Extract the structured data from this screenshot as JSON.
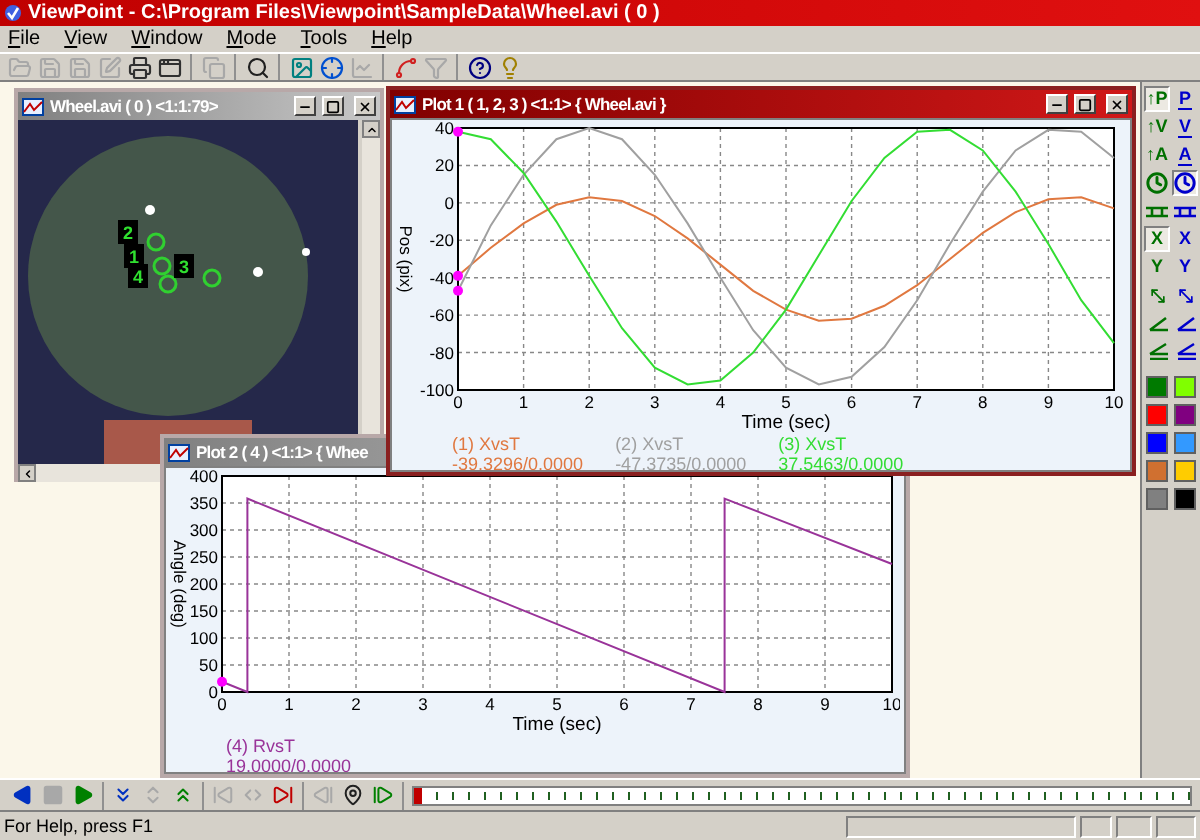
{
  "app_title": "ViewPoint - C:\\Program Files\\Viewpoint\\SampleData\\Wheel.avi ( 0 )",
  "menu": [
    "File",
    "View",
    "Window",
    "Mode",
    "Tools",
    "Help"
  ],
  "toolbar": [
    [
      {
        "kind": "open",
        "disabled": true
      },
      {
        "kind": "save",
        "disabled": true
      },
      {
        "kind": "save",
        "disabled": true
      },
      {
        "kind": "edit",
        "disabled": true
      },
      {
        "kind": "print",
        "disabled": false
      },
      {
        "kind": "window",
        "disabled": false
      }
    ],
    [
      {
        "kind": "copy",
        "disabled": true
      }
    ],
    [
      {
        "kind": "zoom",
        "disabled": false
      }
    ],
    [
      {
        "kind": "image",
        "disabled": false
      },
      {
        "kind": "target",
        "disabled": false
      },
      {
        "kind": "chart",
        "disabled": true
      }
    ],
    [
      {
        "kind": "points",
        "disabled": false
      },
      {
        "kind": "filter",
        "disabled": true
      }
    ],
    [
      {
        "kind": "help",
        "disabled": false
      },
      {
        "kind": "tip",
        "disabled": false
      }
    ]
  ],
  "video_window": {
    "title": "Wheel.avi ( 0 ) <1:1:79>",
    "active": false,
    "markers": [
      {
        "label": "2"
      },
      {
        "label": "1"
      },
      {
        "label": "4"
      },
      {
        "label": "3"
      }
    ]
  },
  "plot_window_1": {
    "title": "Plot 1 ( 1, 2, 3 ) <1:1> { Wheel.avi }",
    "active": true,
    "chart_data": {
      "type": "line",
      "xlabel": "Time (sec)",
      "ylabel": "Pos (pix)",
      "xlim": [
        0,
        10
      ],
      "ylim": [
        -100,
        40
      ],
      "xticks": [
        0,
        1,
        2,
        3,
        4,
        5,
        6,
        7,
        8,
        9,
        10
      ],
      "yticks": [
        -100,
        -80,
        -60,
        -40,
        -20,
        0,
        20,
        40
      ],
      "grid": true,
      "x": [
        0,
        0.5,
        1,
        1.5,
        2,
        2.5,
        3,
        3.5,
        4,
        4.5,
        5,
        5.5,
        6,
        6.5,
        7,
        7.5,
        8,
        8.5,
        9,
        9.5,
        10
      ],
      "series": [
        {
          "name": "(1) XvsT",
          "color": "#e07840",
          "values": [
            -39,
            -24,
            -11,
            -1,
            3,
            1,
            -7,
            -19,
            -33,
            -47,
            -57,
            -63,
            -62,
            -55,
            -44,
            -30,
            -16,
            -5,
            2,
            3,
            -3
          ]
        },
        {
          "name": "(2) XvsT",
          "color": "#a0a0a0",
          "values": [
            -47,
            -12,
            15,
            34,
            40,
            34,
            15,
            -11,
            -40,
            -68,
            -88,
            -97,
            -93,
            -77,
            -52,
            -22,
            6,
            28,
            39,
            38,
            24
          ]
        },
        {
          "name": "(3) XvsT",
          "color": "#33dd33",
          "values": [
            38,
            34,
            16,
            -10,
            -39,
            -67,
            -88,
            -97,
            -95,
            -80,
            -57,
            -28,
            1,
            24,
            38,
            39,
            28,
            6,
            -22,
            -52,
            -75
          ]
        }
      ]
    },
    "readings": [
      "-39.3296/0.0000",
      "-47.3735/0.0000",
      "37.5463/0.0000"
    ]
  },
  "plot_window_2": {
    "title": "Plot 2 ( 4 ) <1:1> { Whee",
    "active": false,
    "chart_data": {
      "type": "line",
      "xlabel": "Time (sec)",
      "ylabel": "Angle (deg)",
      "xlim": [
        0,
        10
      ],
      "ylim": [
        0,
        400
      ],
      "xticks": [
        0,
        1,
        2,
        3,
        4,
        5,
        6,
        7,
        8,
        9,
        10
      ],
      "yticks": [
        0,
        50,
        100,
        150,
        200,
        250,
        300,
        350,
        400
      ],
      "grid": true,
      "x": [
        0,
        0.38,
        0.38,
        7.5,
        7.5,
        10
      ],
      "series": [
        {
          "name": "(4) RvsT",
          "color": "#993399",
          "values": [
            19,
            0,
            358,
            0,
            358,
            237
          ]
        }
      ]
    },
    "readings": [
      "19.0000/0.0000"
    ]
  },
  "tool_palette": [
    {
      "kind": "letter",
      "label": "↑P",
      "color": "#007000",
      "selected": true
    },
    {
      "kind": "vector",
      "label": "P",
      "color": "#0000cc",
      "selected": false
    },
    {
      "kind": "letter",
      "label": "↑V",
      "color": "#007000",
      "selected": false
    },
    {
      "kind": "vector",
      "label": "V",
      "color": "#0000cc",
      "selected": false
    },
    {
      "kind": "letter",
      "label": "↑A",
      "color": "#007000",
      "selected": false
    },
    {
      "kind": "vector",
      "label": "A",
      "color": "#0000cc",
      "selected": false
    },
    {
      "kind": "clock",
      "color": "#007000",
      "selected": false
    },
    {
      "kind": "clock",
      "color": "#0000cc",
      "selected": true
    },
    {
      "kind": "bars",
      "color": "#007000",
      "selected": false
    },
    {
      "kind": "bars",
      "color": "#0000cc",
      "selected": false
    },
    {
      "kind": "letter",
      "label": "X",
      "color": "#007000",
      "selected": true
    },
    {
      "kind": "letter",
      "label": "X",
      "color": "#0000cc",
      "selected": false
    },
    {
      "kind": "letter",
      "label": "Y",
      "color": "#007000",
      "selected": false
    },
    {
      "kind": "letter",
      "label": "Y",
      "color": "#0000cc",
      "selected": false
    },
    {
      "kind": "diagonal",
      "color": "#007000",
      "selected": false
    },
    {
      "kind": "diagonal",
      "color": "#0000cc",
      "selected": false
    },
    {
      "kind": "angle",
      "color": "#007000",
      "selected": false
    },
    {
      "kind": "angle",
      "color": "#0000cc",
      "selected": false
    },
    {
      "kind": "angle_line",
      "color": "#007000",
      "selected": false
    },
    {
      "kind": "angle_line",
      "color": "#0000cc",
      "selected": false
    }
  ],
  "color_palette": [
    {
      "color": "#007a00"
    },
    {
      "color": "#80ff00"
    },
    {
      "color": "#ff0000"
    },
    {
      "color": "#800080"
    },
    {
      "color": "#0000ff"
    },
    {
      "color": "#3399ff"
    },
    {
      "color": "#d07030"
    },
    {
      "color": "#ffcc00"
    },
    {
      "color": "#808080"
    },
    {
      "color": "#000000"
    }
  ],
  "transport": [
    [
      {
        "kind": "reverse",
        "disabled": false
      },
      {
        "kind": "stop",
        "disabled": true
      },
      {
        "kind": "play",
        "disabled": false
      }
    ],
    [
      {
        "kind": "down",
        "disabled": false
      },
      {
        "kind": "updown",
        "disabled": true
      },
      {
        "kind": "up",
        "disabled": false
      }
    ],
    [
      {
        "kind": "first",
        "disabled": true
      },
      {
        "kind": "leftright",
        "disabled": true
      },
      {
        "kind": "last",
        "disabled": false
      }
    ],
    [
      {
        "kind": "stepback",
        "disabled": true
      },
      {
        "kind": "mark",
        "disabled": false
      },
      {
        "kind": "stepforward",
        "disabled": false
      }
    ]
  ],
  "timeline": {
    "level": 0
  },
  "status_text": "For Help, press F1"
}
